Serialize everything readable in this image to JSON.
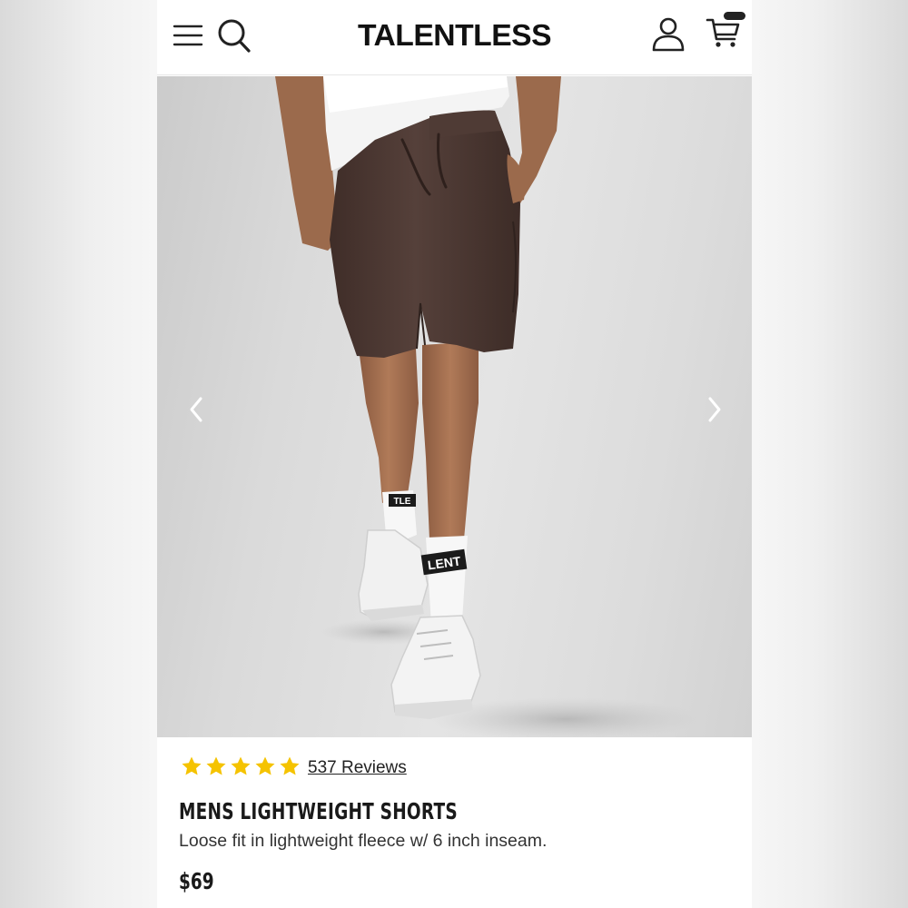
{
  "header": {
    "brand": "TALENTLESS",
    "icons": [
      "menu-icon",
      "search-icon",
      "account-icon",
      "cart-icon"
    ]
  },
  "product_image": {
    "sock_text_left": "TLE",
    "sock_text_right": "LENT",
    "controls": [
      "chevron-left-icon",
      "chevron-right-icon"
    ]
  },
  "product": {
    "rating": 5,
    "reviews_label": "537 Reviews",
    "title": "MENS LIGHTWEIGHT SHORTS",
    "description": "Loose fit in lightweight fleece w/ 6 inch inseam.",
    "price": "$69"
  },
  "colors": {
    "star": "#f5c300",
    "shorts": "#4a3530",
    "text": "#1a1a1a"
  }
}
